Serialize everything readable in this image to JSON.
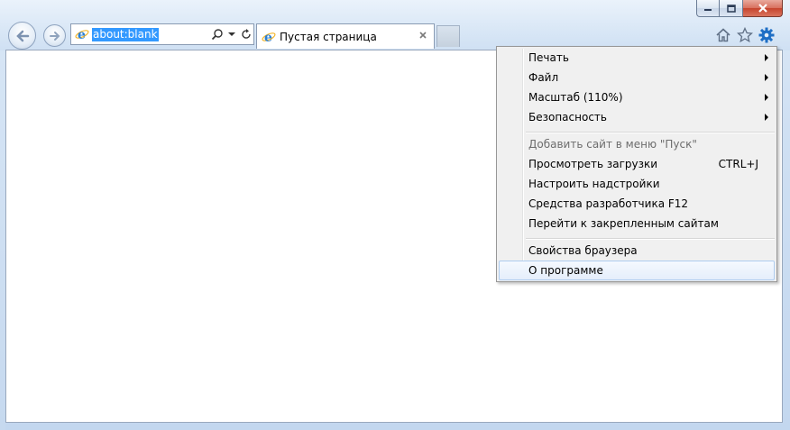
{
  "window": {
    "controls": {
      "minimize_icon": "minimize-icon",
      "maximize_icon": "maximize-icon",
      "close_icon": "close-icon"
    }
  },
  "address": {
    "value": "about:blank"
  },
  "tab": {
    "title": "Пустая страница"
  },
  "menu": {
    "items": [
      {
        "label": "Печать",
        "submenu": true
      },
      {
        "label": "Файл",
        "submenu": true
      },
      {
        "label": "Масштаб (110%)",
        "submenu": true
      },
      {
        "label": "Безопасность",
        "submenu": true
      },
      {
        "label": "Добавить сайт в меню \"Пуск\"",
        "disabled": true
      },
      {
        "label": "Просмотреть загрузки",
        "shortcut": "CTRL+J"
      },
      {
        "label": "Настроить надстройки"
      },
      {
        "label": "Средства разработчика F12"
      },
      {
        "label": "Перейти к закрепленным сайтам"
      },
      {
        "label": "Свойства браузера"
      },
      {
        "label": "О программе",
        "highlighted": true
      }
    ]
  },
  "colors": {
    "accent": "#3399ff",
    "gear": "#1f6fc5",
    "close": "#c6442d"
  }
}
